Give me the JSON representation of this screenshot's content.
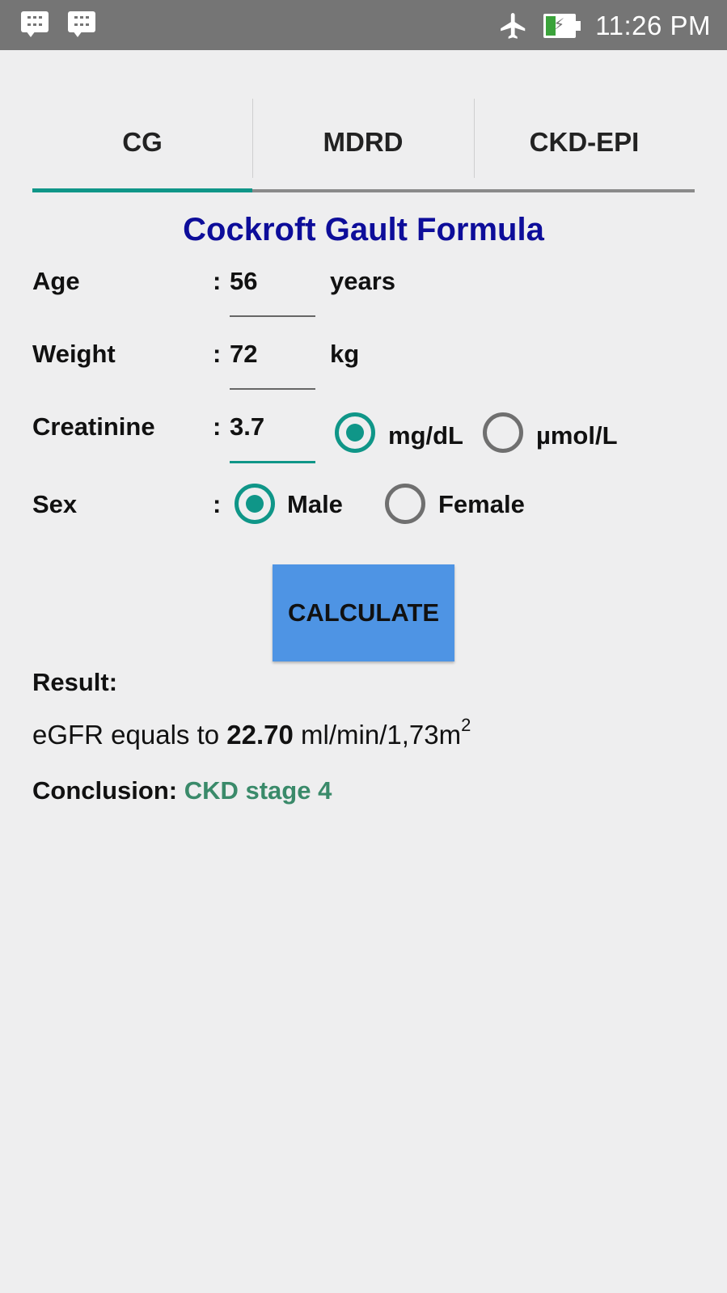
{
  "status_bar": {
    "notification_icons": [
      "bbm-chat-icon",
      "bbm-message-icon"
    ],
    "time": "11:26 PM",
    "battery_level": 0.35,
    "battery_color": "#3ba33b"
  },
  "tabs": [
    {
      "label": "CG",
      "selected": true
    },
    {
      "label": "MDRD",
      "selected": false
    },
    {
      "label": "CKD-EPI",
      "selected": false
    }
  ],
  "accent_color": "#0f9688",
  "title": "Cockroft Gault Formula",
  "form": {
    "age": {
      "label": "Age",
      "colon": ":",
      "value": "56",
      "unit": "years"
    },
    "weight": {
      "label": "Weight",
      "colon": ":",
      "value": "72",
      "unit": "kg"
    },
    "creatinine": {
      "label": "Creatinine",
      "colon": ":",
      "value": "3.7",
      "units": [
        {
          "label": "mg/dL",
          "checked": true
        },
        {
          "label": "µmol/L",
          "checked": false
        }
      ]
    },
    "sex": {
      "label": "Sex",
      "colon": ":",
      "options": [
        {
          "label": "Male",
          "checked": true
        },
        {
          "label": "Female",
          "checked": false
        }
      ]
    }
  },
  "calculate_button": {
    "label": "CALCULATE",
    "color": "#4e94e4"
  },
  "result": {
    "heading": "Result:",
    "egfr_prefix": "eGFR equals to ",
    "egfr_value": "22.70",
    "egfr_unit": " ml/min/1,73m",
    "egfr_unit_sup": "2",
    "conclusion_label": "Conclusion: ",
    "conclusion_value": "CKD stage 4",
    "conclusion_color": "#3a8a6a"
  }
}
